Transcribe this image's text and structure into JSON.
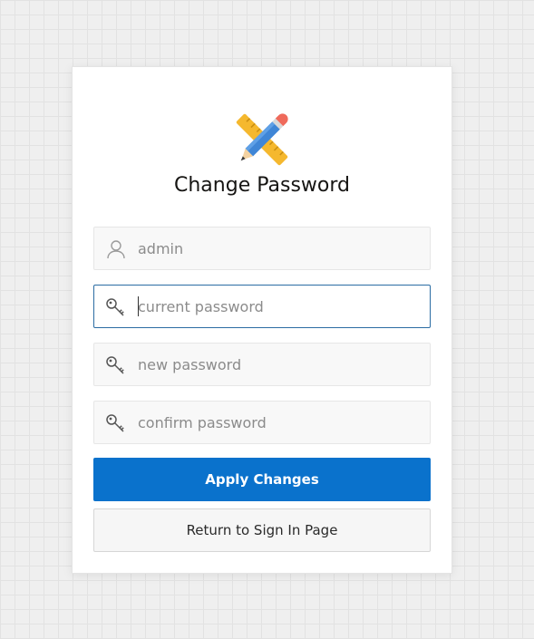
{
  "page": {
    "title": "Change Password",
    "logo_icon": "pencil-ruler-icon"
  },
  "form": {
    "username": {
      "value": "admin",
      "icon": "user-icon"
    },
    "current_password": {
      "placeholder": "current password",
      "icon": "key-icon",
      "focused": true
    },
    "new_password": {
      "placeholder": "new password",
      "icon": "key-icon"
    },
    "confirm_password": {
      "placeholder": "confirm password",
      "icon": "key-icon"
    }
  },
  "actions": {
    "apply_label": "Apply Changes",
    "return_label": "Return to Sign In Page"
  },
  "colors": {
    "primary": "#0a72cc",
    "focus_border": "#2b6ca3",
    "background": "#efefef"
  }
}
